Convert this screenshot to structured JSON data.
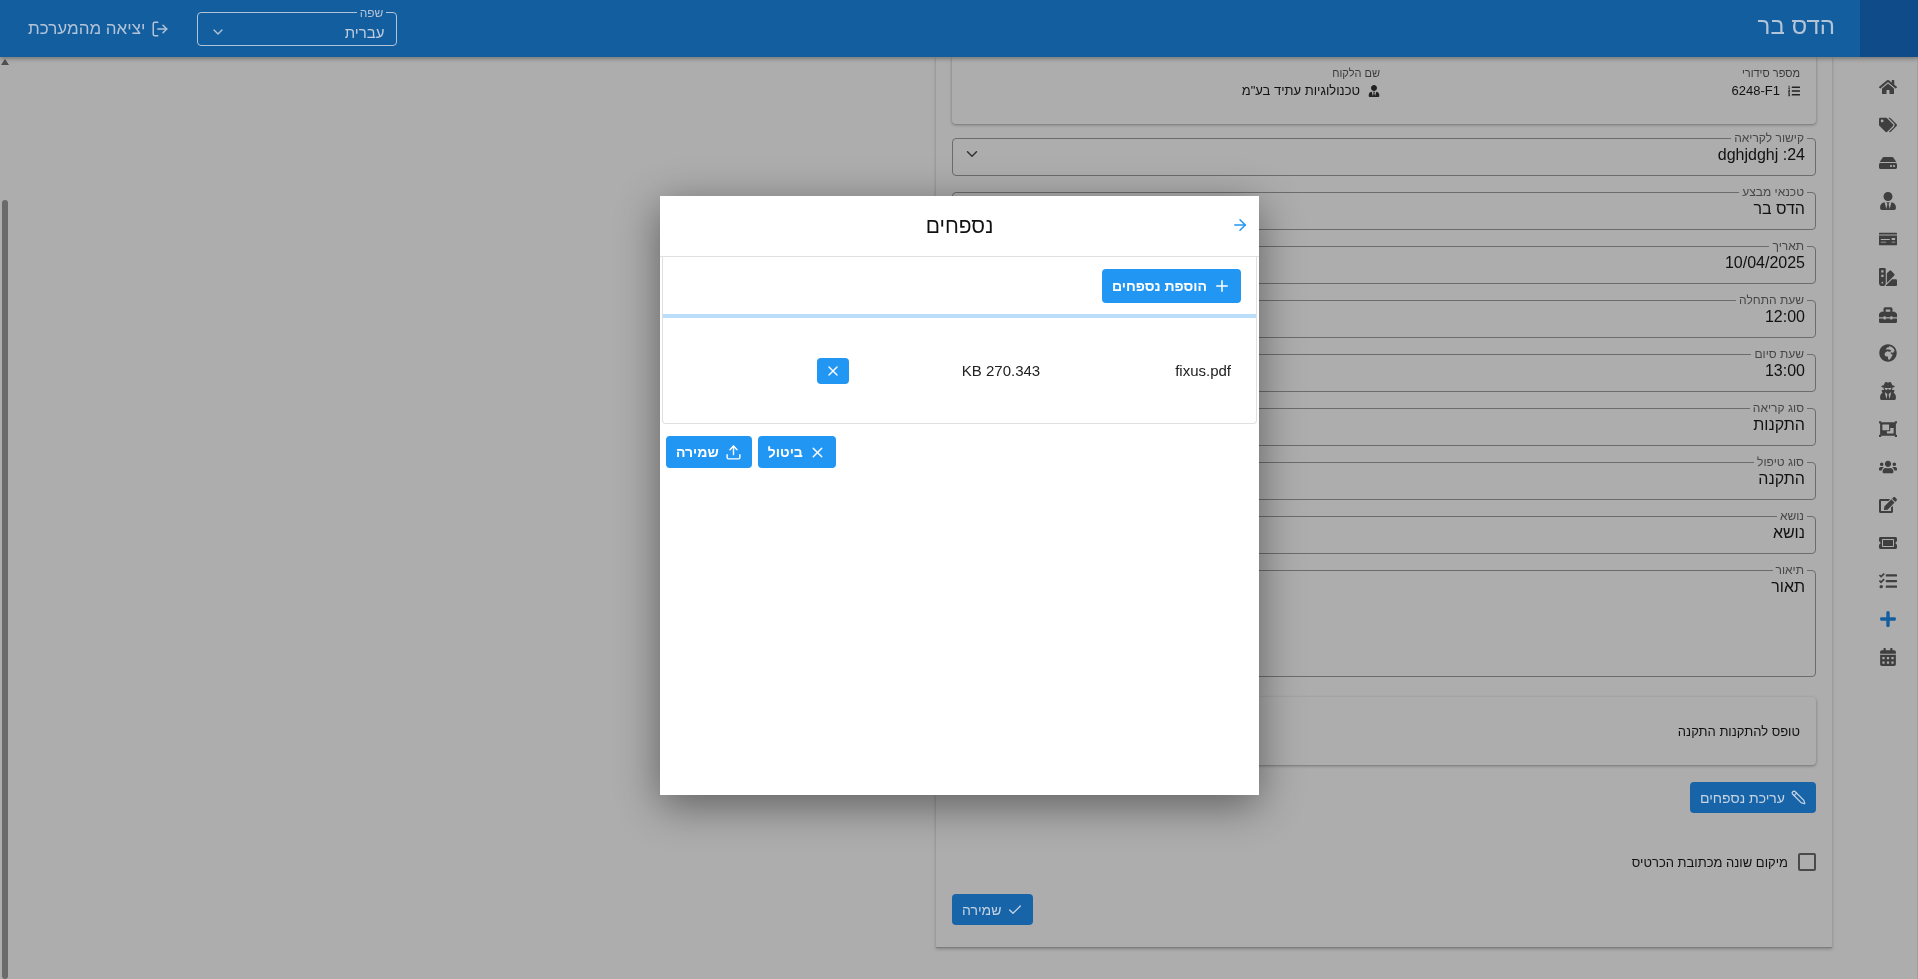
{
  "top_bar": {
    "title": "הדס בר",
    "language": {
      "label": "שפה",
      "value": "עברית"
    },
    "logout": "יציאה מהמערכת"
  },
  "sidebar": {
    "items": [
      {
        "selected": false
      },
      {
        "selected": false
      },
      {
        "selected": false
      },
      {
        "selected": false
      },
      {
        "selected": false
      },
      {
        "selected": false
      },
      {
        "selected": false
      },
      {
        "selected": false
      },
      {
        "selected": false
      },
      {
        "selected": false
      },
      {
        "selected": false
      },
      {
        "selected": false
      },
      {
        "selected": false
      },
      {
        "selected": false
      },
      {
        "selected": true
      },
      {
        "selected": false
      }
    ]
  },
  "form": {
    "summary": [
      {
        "label": "מספר סידורי",
        "value": "6248-F1",
        "kind": "serial"
      },
      {
        "label": "שם הלקוח",
        "value": "טכנולוגיות עתיד בע\"מ",
        "kind": "customer"
      }
    ],
    "fields": [
      {
        "label": "קישור לקריאה",
        "value": "dghjdghj :24",
        "kind": "select"
      },
      {
        "label": "טכנאי מבצע",
        "value": "הדס בר",
        "kind": "text"
      },
      {
        "label": "תאריך",
        "value": "10/04/2025",
        "kind": "text"
      },
      {
        "label": "שעת התחלה",
        "value": "12:00",
        "kind": "text"
      },
      {
        "label": "שעת סיום",
        "value": "13:00",
        "kind": "text"
      },
      {
        "label": "סוג קריאה",
        "value": "התקנות",
        "kind": "text"
      },
      {
        "label": "סוג טיפול",
        "value": "התקנה",
        "kind": "text"
      },
      {
        "label": "נושא",
        "value": "נושא",
        "kind": "text"
      },
      {
        "label": "תיאור",
        "value": "תאור",
        "kind": "textarea"
      }
    ],
    "form_card": "טופס להתקנות התקנה",
    "edit_attachments_button": "עריכת נספחים",
    "checkbox": {
      "label": "מיקום שונה מכתובת הכרטיס",
      "checked": false
    },
    "save_button": "שמירה"
  },
  "dialog": {
    "title": "נספחים",
    "add_button": "הוספת נספחים",
    "files": [
      {
        "name": "fixus.pdf",
        "size": "KB 270.343"
      }
    ],
    "buttons": [
      {
        "label": "ביטול",
        "kind": "cancel"
      },
      {
        "label": "שמירה",
        "kind": "save"
      }
    ]
  }
}
